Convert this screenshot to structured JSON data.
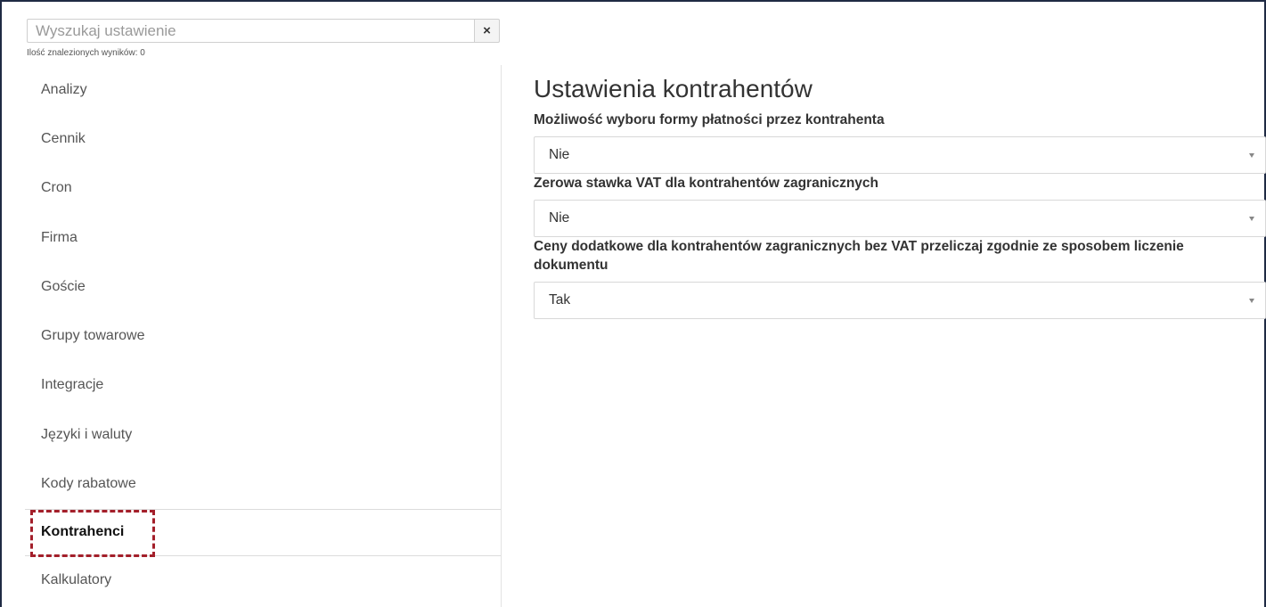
{
  "search": {
    "placeholder": "Wyszukaj ustawienie",
    "clear_label": "×",
    "results_text": "Ilość znalezionych wyników: 0"
  },
  "sidebar": {
    "items": [
      {
        "label": "Analizy"
      },
      {
        "label": "Cennik"
      },
      {
        "label": "Cron"
      },
      {
        "label": "Firma"
      },
      {
        "label": "Goście"
      },
      {
        "label": "Grupy towarowe"
      },
      {
        "label": "Integracje"
      },
      {
        "label": "Języki i waluty"
      },
      {
        "label": "Kody rabatowe"
      },
      {
        "label": "Kontrahenci",
        "active": true
      },
      {
        "label": "Kalkulatory"
      }
    ]
  },
  "main": {
    "title": "Ustawienia kontrahentów",
    "fields": [
      {
        "label": "Możliwość wyboru formy płatności przez kontrahenta",
        "value": "Nie"
      },
      {
        "label": "Zerowa stawka VAT dla kontrahentów zagranicznych",
        "value": "Nie"
      },
      {
        "label": "Ceny dodatkowe dla kontrahentów zagranicznych bez VAT przeliczaj zgodnie ze sposobem liczenie dokumentu",
        "value": "Tak"
      }
    ]
  },
  "colors": {
    "highlight": "#a31f2a",
    "frame": "#1f2a44"
  }
}
